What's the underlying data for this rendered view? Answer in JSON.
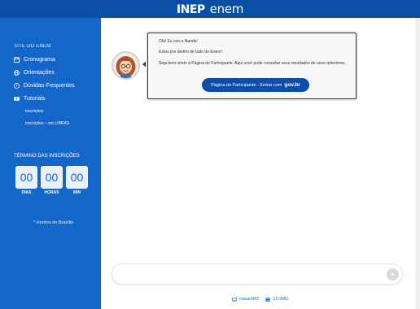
{
  "header": {
    "logo_inep": "INEP",
    "logo_enem": "enem"
  },
  "sidebar": {
    "heading": "SITE DO ENEM",
    "items": [
      {
        "label": "Cronograma",
        "icon": "calendar-icon"
      },
      {
        "label": "Orientações",
        "icon": "globe-icon"
      },
      {
        "label": "Dúvidas Frequentes",
        "icon": "help-circle-icon"
      },
      {
        "label": "Tutoriais",
        "icon": "video-icon"
      }
    ],
    "subitems": [
      {
        "label": "Inscrições"
      },
      {
        "label": "Inscrições – em LIBRAS"
      }
    ]
  },
  "countdown": {
    "heading": "TÉRMINO DAS INSCRIÇÕES",
    "days": "00",
    "hours": "00",
    "minutes": "00",
    "days_label": "DIAS",
    "hours_label": "HORAS",
    "minutes_label": "MIN",
    "note": "* Horário de Brasília"
  },
  "chat": {
    "line1": "Olá! Eu sou a Nanda!",
    "line2": "Estou por dentro de tudo do Enem!",
    "line3": "Seja bem-vindo à Página do Participante. Aqui você pode consultar seus resultados de anos anteriores.",
    "button_label": "Página do Participante - Entrar com",
    "button_brand": "gov.br",
    "input_placeholder": ""
  },
  "footer": {
    "server": "master943",
    "version": "3.0.9952"
  },
  "colors": {
    "topbar": "#0a4fa3",
    "sidebar": "#1466c8",
    "button": "#0d4ea8"
  }
}
